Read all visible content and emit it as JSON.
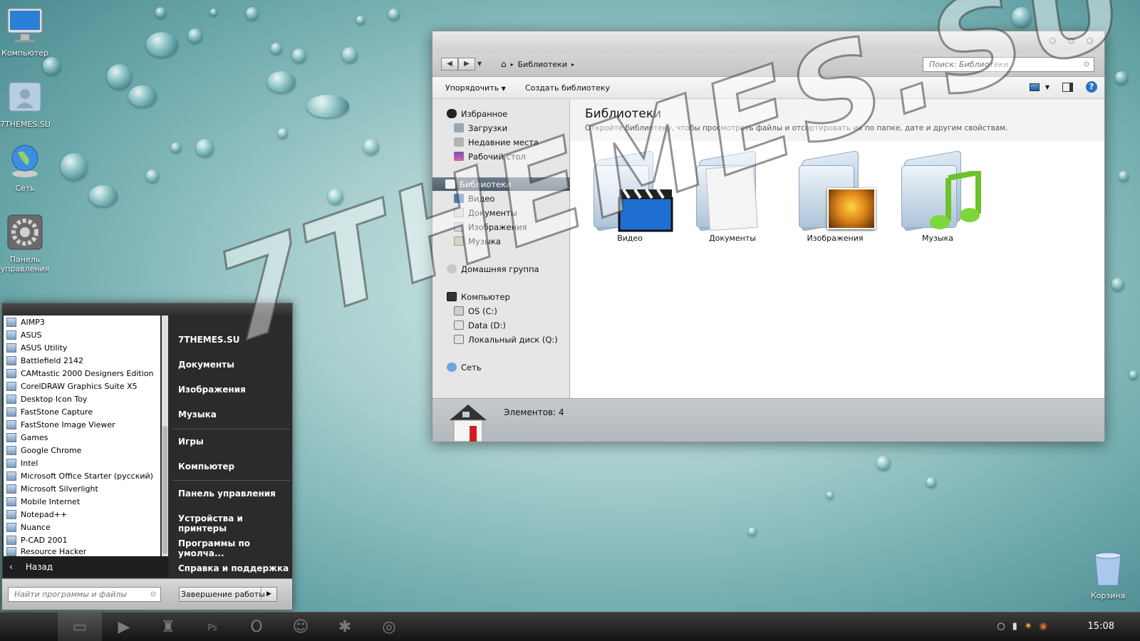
{
  "desktop": {
    "icons": [
      {
        "label": "Компьютер"
      },
      {
        "label": "7THEMES.SU"
      },
      {
        "label": "Сеть"
      },
      {
        "label": "Панель управления"
      },
      {
        "label": "Корзина"
      }
    ]
  },
  "watermark": "7THEMES.SU",
  "explorer": {
    "breadcrumb": [
      "Библиотеки"
    ],
    "search_placeholder": "Поиск: Библиотеки",
    "toolbar": {
      "organize": "Упорядочить",
      "create_library": "Создать библиотеку"
    },
    "sidebar": {
      "favorites": "Избранное",
      "favorites_items": [
        "Загрузки",
        "Недавние места",
        "Рабочий стол"
      ],
      "libraries": "Библиотеки",
      "libraries_items": [
        "Видео",
        "Документы",
        "Изображения",
        "Музыка"
      ],
      "homegroup": "Домашняя группа",
      "computer": "Компьютер",
      "computer_items": [
        "OS (C:)",
        "Data (D:)",
        "Локальный диск (Q:)"
      ],
      "network": "Сеть"
    },
    "content": {
      "title": "Библиотеки",
      "subtitle": "Откройте библиотеку, чтобы просмотреть файлы и отсортировать их по папке, дате и другим свойствам.",
      "libraries": [
        "Видео",
        "Документы",
        "Изображения",
        "Музыка"
      ]
    },
    "status": "Элементов: 4"
  },
  "startmenu": {
    "programs": [
      "AIMP3",
      "ASUS",
      "ASUS Utility",
      "Battlefield 2142",
      "CAMtastic 2000 Designers Edition",
      "CorelDRAW Graphics Suite X5",
      "Desktop Icon Toy",
      "FastStone Capture",
      "FastStone Image Viewer",
      "Games",
      "Google Chrome",
      "Intel",
      "Microsoft Office Starter (русский)",
      "Microsoft Silverlight",
      "Mobile Internet",
      "Notepad++",
      "Nuance",
      "P-CAD 2001",
      "Resource Hacker"
    ],
    "back": "Назад",
    "right_links": [
      "7THEMES.SU",
      "Документы",
      "Изображения",
      "Музыка",
      "Игры",
      "Компьютер",
      "Панель управления",
      "Устройства и принтеры",
      "Программы по умолча...",
      "Справка и поддержка"
    ],
    "search_placeholder": "Найти программы и файлы",
    "shutdown": "Завершение работы"
  },
  "taskbar": {
    "clock": "15:08",
    "icons": [
      "apple-icon",
      "explorer-icon",
      "media-player-icon",
      "winamp-icon",
      "photoshop-icon",
      "opera-icon",
      "mac-icon",
      "asterisk-icon",
      "chrome-icon"
    ]
  }
}
